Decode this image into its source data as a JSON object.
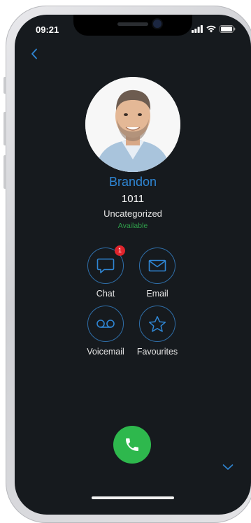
{
  "status_bar": {
    "time": "09:21"
  },
  "contact": {
    "name": "Brandon",
    "extension": "1011",
    "group": "Uncategorized",
    "presence": "Available"
  },
  "actions": {
    "chat": {
      "label": "Chat",
      "badge": "1",
      "icon": "chat-bubble-icon"
    },
    "email": {
      "label": "Email",
      "icon": "envelope-icon"
    },
    "voicemail": {
      "label": "Voicemail",
      "icon": "voicemail-icon"
    },
    "favourites": {
      "label": "Favourites",
      "icon": "star-icon"
    }
  },
  "colors": {
    "background": "#161a1e",
    "accent": "#2f86d4",
    "presence": "#2f9e4a",
    "call": "#2eb84d",
    "badge": "#e0242c"
  }
}
